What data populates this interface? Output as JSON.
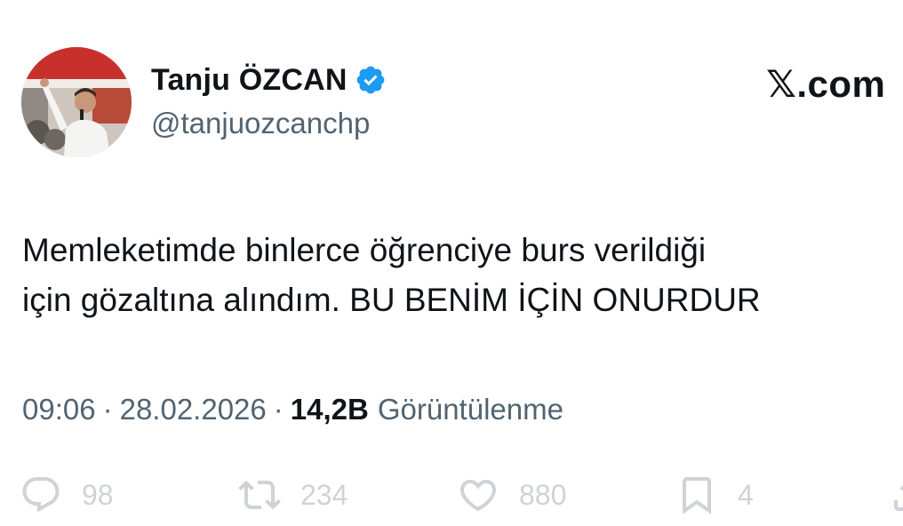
{
  "tweet": {
    "author": {
      "display_name": "Tanju ÖZCAN",
      "handle": "@tanjuozcanchp",
      "verified": true,
      "verified_color": "#1d9bf0"
    },
    "brand_label": "𝕏.com",
    "text_lines": [
      "Memleketimde binlerce öğrenciye burs verildiği",
      "için gözaltına alındım. BU BENİM İÇİN ONURDUR"
    ],
    "time": "09:06",
    "date": "28.02.2026",
    "separator": "·",
    "views_count": "14,2B",
    "views_label": "Görüntülenme",
    "actions": {
      "replies": "98",
      "reposts": "234",
      "likes": "880",
      "bookmarks": "4"
    }
  }
}
